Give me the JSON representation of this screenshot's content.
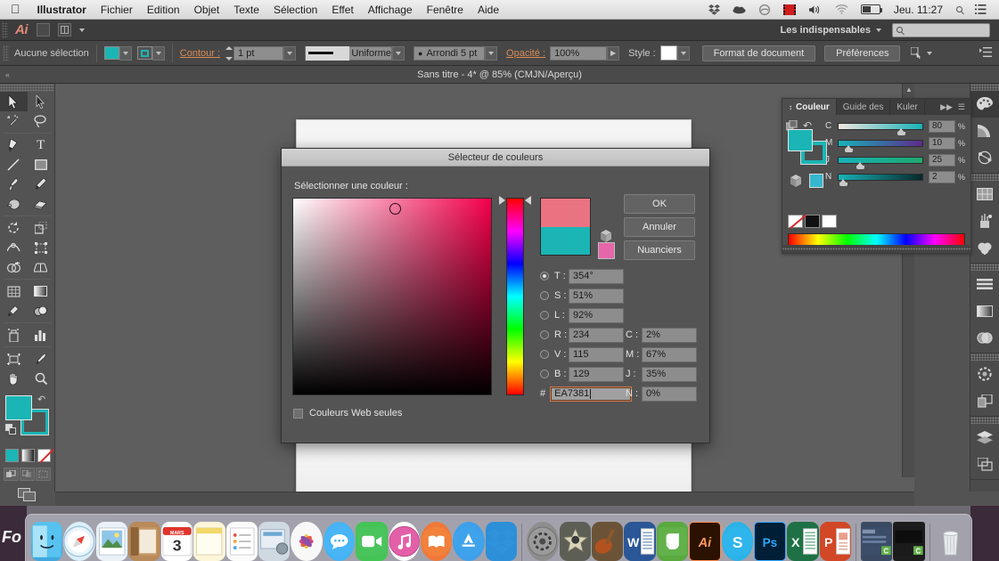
{
  "mac_menu": {
    "apple_icon": "apple-logo",
    "app_name": "Illustrator",
    "items": [
      "Fichier",
      "Edition",
      "Objet",
      "Texte",
      "Sélection",
      "Effet",
      "Affichage",
      "Fenêtre",
      "Aide"
    ],
    "status_icons": [
      "dropbox-icon",
      "cloud-icon",
      "creative-cloud-icon",
      "screenflow-icon",
      "volume-icon",
      "wifi-icon",
      "battery-icon"
    ],
    "clock": "Jeu. 11:27",
    "spotlight_icon": "search-icon",
    "notification_icon": "notification-center-icon"
  },
  "app_bar": {
    "logo": "Ai",
    "bridge_button": "bridge-icon",
    "arrange_button": "arrange-documents-icon",
    "workspace": "Les indispensables",
    "search_placeholder": ""
  },
  "control_bar": {
    "selection_status": "Aucune sélection",
    "fill_color": "#1bb5b5",
    "stroke_color": "#1bb5b5",
    "stroke_label": "Contour :",
    "stroke_weight": "1 pt",
    "stroke_profile": "Uniforme",
    "brush_definition": "Arrondi 5 pt",
    "opacity_label": "Opacité :",
    "opacity_value": "100%",
    "style_label": "Style :",
    "document_setup": "Format de document",
    "preferences": "Préférences"
  },
  "document": {
    "title": "Sans titre - 4* @ 85% (CMJN/Aperçu)"
  },
  "tools": [
    {
      "name": "selection-tool",
      "selected": true
    },
    {
      "name": "direct-selection-tool",
      "selected": false
    },
    {
      "name": "magic-wand-tool",
      "selected": false
    },
    {
      "name": "lasso-tool",
      "selected": false
    },
    {
      "name": "pen-tool",
      "selected": false
    },
    {
      "name": "type-tool",
      "selected": false
    },
    {
      "name": "line-segment-tool",
      "selected": false
    },
    {
      "name": "rectangle-tool",
      "selected": false
    },
    {
      "name": "paintbrush-tool",
      "selected": false
    },
    {
      "name": "pencil-tool",
      "selected": false
    },
    {
      "name": "blob-brush-tool",
      "selected": false
    },
    {
      "name": "eraser-tool",
      "selected": false
    },
    {
      "name": "rotate-tool",
      "selected": false
    },
    {
      "name": "scale-tool",
      "selected": false
    },
    {
      "name": "width-tool",
      "selected": false
    },
    {
      "name": "free-transform-tool",
      "selected": false
    },
    {
      "name": "shape-builder-tool",
      "selected": false
    },
    {
      "name": "perspective-grid-tool",
      "selected": false
    },
    {
      "name": "mesh-tool",
      "selected": false
    },
    {
      "name": "gradient-tool",
      "selected": false
    },
    {
      "name": "eyedropper-tool",
      "selected": false
    },
    {
      "name": "blend-tool",
      "selected": false
    },
    {
      "name": "symbol-sprayer-tool",
      "selected": false
    },
    {
      "name": "column-graph-tool",
      "selected": false
    },
    {
      "name": "artboard-tool",
      "selected": false
    },
    {
      "name": "slice-tool",
      "selected": false
    },
    {
      "name": "hand-tool",
      "selected": false
    },
    {
      "name": "zoom-tool",
      "selected": false
    }
  ],
  "color_panel": {
    "tabs": [
      {
        "label": "Couleur",
        "active": true
      },
      {
        "label": "Guide des",
        "active": false
      },
      {
        "label": "Kuler",
        "active": false
      }
    ],
    "expand_icon": "expand-panel-icon",
    "menu_icon": "panel-menu-icon",
    "fill_color": "#1bb5b5",
    "stroke_color": "#1bb5b5",
    "sliders": [
      {
        "key": "C",
        "value": "80",
        "unit": "%",
        "pos": 73
      },
      {
        "key": "M",
        "value": "10",
        "unit": "%",
        "pos": 9
      },
      {
        "key": "J",
        "value": "25",
        "unit": "%",
        "pos": 24
      },
      {
        "key": "N",
        "value": "2",
        "unit": "%",
        "pos": 2
      }
    ],
    "none_swatch": "none-swatch",
    "black_swatch": "#111111",
    "white_swatch": "#ffffff"
  },
  "right_dock": {
    "groups": [
      [
        "color-panel-icon",
        "color-guide-icon",
        "kuler-icon"
      ],
      [
        "swatches-panel-icon",
        "brushes-panel-icon",
        "symbols-panel-icon"
      ],
      [
        "align-panel-icon",
        "gradient-panel-icon",
        "transparency-panel-icon"
      ],
      [
        "stroke-panel-icon",
        "pathfinder-panel-icon"
      ],
      [
        "layers-panel-icon",
        "artboards-panel-icon"
      ]
    ]
  },
  "dialog": {
    "title": "Sélecteur de couleurs",
    "subtitle": "Sélectionner une couleur :",
    "new_color": "#ea7381",
    "old_color": "#1bb5b5",
    "out_of_gamut_icon": "out-of-gamut-cube-icon",
    "out_of_web_color": "#e666aa",
    "buttons": {
      "ok": "OK",
      "cancel": "Annuler",
      "swatches": "Nuanciers"
    },
    "hsb_rgb": [
      {
        "key": "T :",
        "value": "354°",
        "selected": true
      },
      {
        "key": "S :",
        "value": "51%",
        "selected": false
      },
      {
        "key": "L :",
        "value": "92%",
        "selected": false
      },
      {
        "key": "R :",
        "value": "234",
        "selected": false
      },
      {
        "key": "V :",
        "value": "115",
        "selected": false
      },
      {
        "key": "B :",
        "value": "129",
        "selected": false
      }
    ],
    "hex_label": "#",
    "hex_value": "EA7381",
    "cmyk": [
      {
        "key": "C :",
        "value": "2%"
      },
      {
        "key": "M :",
        "value": "67%"
      },
      {
        "key": "J :",
        "value": "35%"
      },
      {
        "key": "N :",
        "value": "0%"
      }
    ],
    "web_only_label": "Couleurs Web seules",
    "web_only_checked": false
  },
  "dock": {
    "items": [
      {
        "name": "finder",
        "glyph": "☺",
        "bg": "#4fb8e8",
        "running": true
      },
      {
        "name": "safari",
        "glyph": "🧭",
        "bg": "#eaf4fb",
        "running": true
      },
      {
        "name": "preview",
        "glyph": "🖼",
        "bg": "#d8e6f2",
        "running": false
      },
      {
        "name": "contacts",
        "glyph": "📒",
        "bg": "#b98a5a",
        "running": false
      },
      {
        "name": "calendar",
        "glyph": "3",
        "bg": "#ffffff",
        "running": false
      },
      {
        "name": "notes",
        "glyph": "📝",
        "bg": "#fdf6d8",
        "running": false
      },
      {
        "name": "reminders",
        "glyph": "📋",
        "bg": "#fbfbfb",
        "running": false
      },
      {
        "name": "system-preferences-alt",
        "glyph": "🗂",
        "bg": "#cfd9e2",
        "running": false
      },
      {
        "name": "photos",
        "glyph": "❀",
        "bg": "#f6f6f6",
        "running": false
      },
      {
        "name": "messages",
        "glyph": "💬",
        "bg": "#3fb0f2",
        "running": false
      },
      {
        "name": "facetime",
        "glyph": "📹",
        "bg": "#45c455",
        "running": false
      },
      {
        "name": "itunes",
        "glyph": "♫",
        "bg": "#e05fa8",
        "running": false
      },
      {
        "name": "ibooks",
        "glyph": "📖",
        "bg": "#f07838",
        "running": false
      },
      {
        "name": "app-store",
        "glyph": "A",
        "bg": "#3ea0ea",
        "running": false
      },
      {
        "name": "dropbox",
        "glyph": "◈",
        "bg": "#2d8fd8",
        "running": false
      },
      {
        "name": "system-preferences",
        "glyph": "⚙",
        "bg": "#8d8d8d",
        "running": false
      },
      {
        "name": "imovie",
        "glyph": "★",
        "bg": "#5d5f55",
        "running": false
      },
      {
        "name": "garageband",
        "glyph": "🎸",
        "bg": "#6b5338",
        "running": false
      },
      {
        "name": "word",
        "glyph": "W",
        "bg": "#2b5797",
        "running": true
      },
      {
        "name": "evernote",
        "glyph": "C",
        "bg": "#5aa93f",
        "running": true
      },
      {
        "name": "illustrator",
        "glyph": "Ai",
        "bg": "#2b1200",
        "running": true
      },
      {
        "name": "skype",
        "glyph": "S",
        "bg": "#2ab3e8",
        "running": true
      },
      {
        "name": "photoshop",
        "glyph": "Ps",
        "bg": "#001e36",
        "running": true
      },
      {
        "name": "excel",
        "glyph": "X",
        "bg": "#1e7145",
        "running": true
      },
      {
        "name": "powerpoint",
        "glyph": "P",
        "bg": "#d24726",
        "running": true
      },
      {
        "name": "finder-window-1",
        "glyph": "▤",
        "bg": "#3a4a63",
        "running": false
      },
      {
        "name": "finder-window-2",
        "glyph": "▤",
        "bg": "#1d1d1d",
        "running": false
      },
      {
        "name": "trash",
        "glyph": "🗑",
        "bg": "#e8e8ea",
        "running": false
      }
    ]
  },
  "desktop": {
    "wallpaper_text": "Fo"
  }
}
